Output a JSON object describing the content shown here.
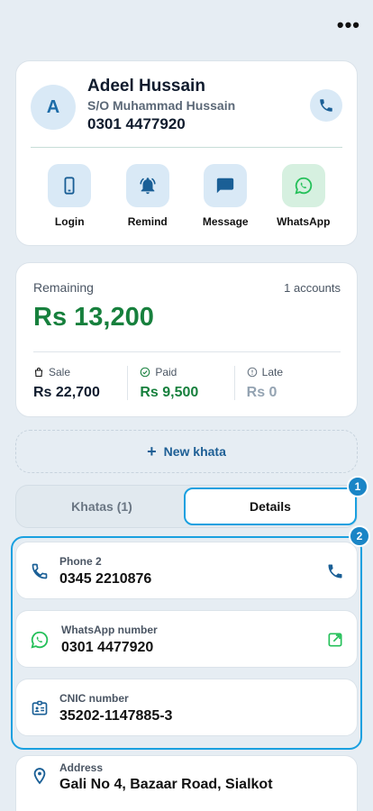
{
  "header": {
    "more_label": "•••"
  },
  "profile": {
    "initial": "A",
    "name": "Adeel Hussain",
    "parent": "S/O Muhammad Hussain",
    "phone": "0301 4477920",
    "actions": [
      {
        "label": "Login",
        "icon": "phone-device-icon"
      },
      {
        "label": "Remind",
        "icon": "bell-icon"
      },
      {
        "label": "Message",
        "icon": "message-icon"
      },
      {
        "label": "WhatsApp",
        "icon": "whatsapp-icon"
      }
    ]
  },
  "summary": {
    "remaining_label": "Remaining",
    "accounts_label": "1 accounts",
    "remaining_amount": "Rs 13,200",
    "sale_label": "Sale",
    "sale_value": "Rs 22,700",
    "paid_label": "Paid",
    "paid_value": "Rs 9,500",
    "late_label": "Late",
    "late_value": "Rs 0"
  },
  "new_khata": {
    "plus": "+",
    "label": "New khata"
  },
  "tabs": {
    "khatas": "Khatas (1)",
    "details": "Details"
  },
  "badges": {
    "one": "1",
    "two": "2"
  },
  "details": [
    {
      "label": "Phone 2",
      "value": "0345 2210876",
      "icon": "phone-icon",
      "action_icon": "phone-icon"
    },
    {
      "label": "WhatsApp number",
      "value": "0301 4477920",
      "icon": "whatsapp-icon",
      "action_icon": "open-external-icon"
    },
    {
      "label": "CNIC number",
      "value": "35202-1147885-3",
      "icon": "id-card-icon"
    },
    {
      "label": "Address",
      "value": "Gali No 4, Bazaar Road, Sialkot",
      "icon": "location-icon"
    }
  ],
  "colors": {
    "accent": "#1a85c6",
    "highlight": "#1aa0e0",
    "green": "#17803d",
    "whatsapp": "#25c05a"
  }
}
